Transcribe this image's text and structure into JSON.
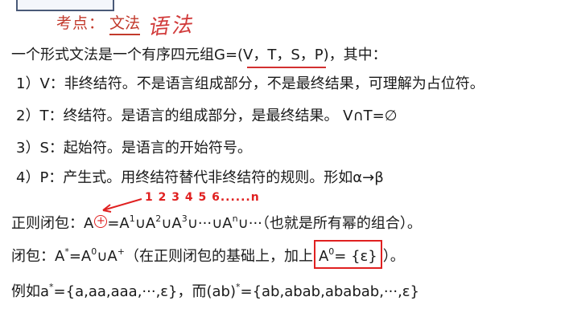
{
  "header": {
    "topic_label": "考点：",
    "topic_value": "文法",
    "handwritten_note": "语法"
  },
  "lines": {
    "definition": {
      "prefix": "一个形式文法是一个有序四元组G=",
      "tuple": "(V，T，S，P)",
      "suffix": "，其中："
    },
    "item1": "1）V：非终结符。不是语言组成部分，不是最终结果，可理解为占位符。",
    "item2": "2）T：终结符。是语言的组成部分，是最终结果。 V∩T=∅",
    "item3": "3）S：起始符。是语言的开始符号。",
    "item4": "4）P：产生式。用终结符替代非终结符的规则。形如α→β",
    "positive_closure": {
      "label": "正则闭包：A",
      "plus": "+",
      "eq": "=A",
      "s1": "1",
      "u1": "∪A",
      "s2": "2",
      "u2": "∪A",
      "s3": "3",
      "u3": "∪···∪A",
      "sn": "n",
      "tail": "∪···（也就是所有幂的组合）。"
    },
    "closure": {
      "label": "闭包：A",
      "star": "*",
      "eq": "=A",
      "s0": "0",
      "union": "∪A",
      "plus": "+",
      "note": "（在正则闭包的基础上，加上",
      "boxed_a": "A",
      "boxed_sup": "0",
      "boxed_rest": "= {ε}",
      "end": "）。"
    },
    "example": {
      "prefix": "例如a",
      "star1": "*",
      "set1": "={a,aa,aaa,···,ε}，而(ab)",
      "star2": "*",
      "set2": "={ab,abab,ababab,···,ε}"
    }
  },
  "annotation": {
    "numbers": "1 2 3 4 5 6......n"
  },
  "colors": {
    "accent_red": "#e02020",
    "header_red": "#c23a2c",
    "text": "#1a1a1a"
  }
}
